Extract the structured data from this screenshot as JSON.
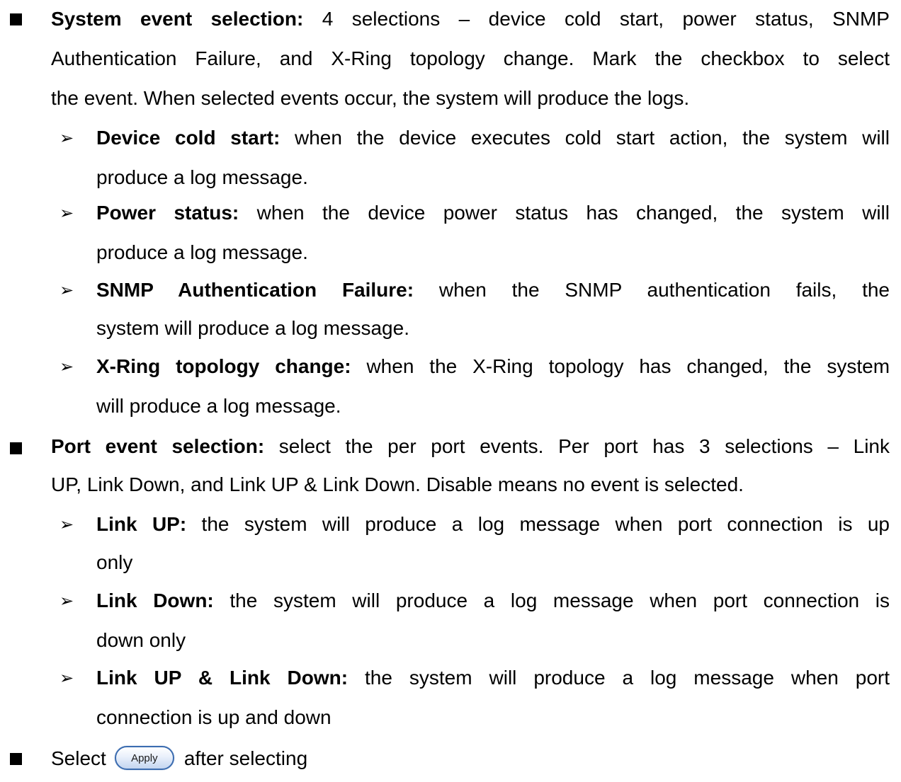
{
  "system_event": {
    "title": "System event selection:",
    "line1_rest": " 4 selections – device cold start, power status, SNMP",
    "line2": "Authentication Failure, and X-Ring topology change. Mark the checkbox to select",
    "line3": "the event. When selected events occur, the system will produce the logs.",
    "items": [
      {
        "term": "Device cold start:",
        "line1_rest": " when the device executes cold start action, the system will",
        "line2": "produce a log message."
      },
      {
        "term": "Power status:",
        "line1_rest": " when the device power status has changed, the system will",
        "line2": "produce a log message."
      },
      {
        "term": "SNMP Authentication Failure:",
        "line1_rest": " when the SNMP authentication fails, the",
        "line2": "system will produce a log message."
      },
      {
        "term": "X-Ring topology change:",
        "line1_rest": " when the X-Ring topology has changed, the system",
        "line2": "will produce a log message."
      }
    ]
  },
  "port_event": {
    "title": "Port event selection:",
    "line1_rest": " select the per port events. Per port has 3 selections – Link",
    "line2": "UP, Link Down, and Link UP & Link Down. Disable means no event is selected.",
    "items": [
      {
        "term": "Link UP:",
        "line1_rest": " the system will produce a log message when port connection is up",
        "line2": "only"
      },
      {
        "term": "Link Down:",
        "line1_rest": " the system will produce a log message when port connection is",
        "line2": "down only"
      },
      {
        "term": "Link UP & Link Down:",
        "line1_rest": " the system will produce a log message when port",
        "line2": "connection is up and down"
      }
    ]
  },
  "final": {
    "prefix": "Select",
    "button_label": "Apply",
    "suffix": "after selecting"
  }
}
